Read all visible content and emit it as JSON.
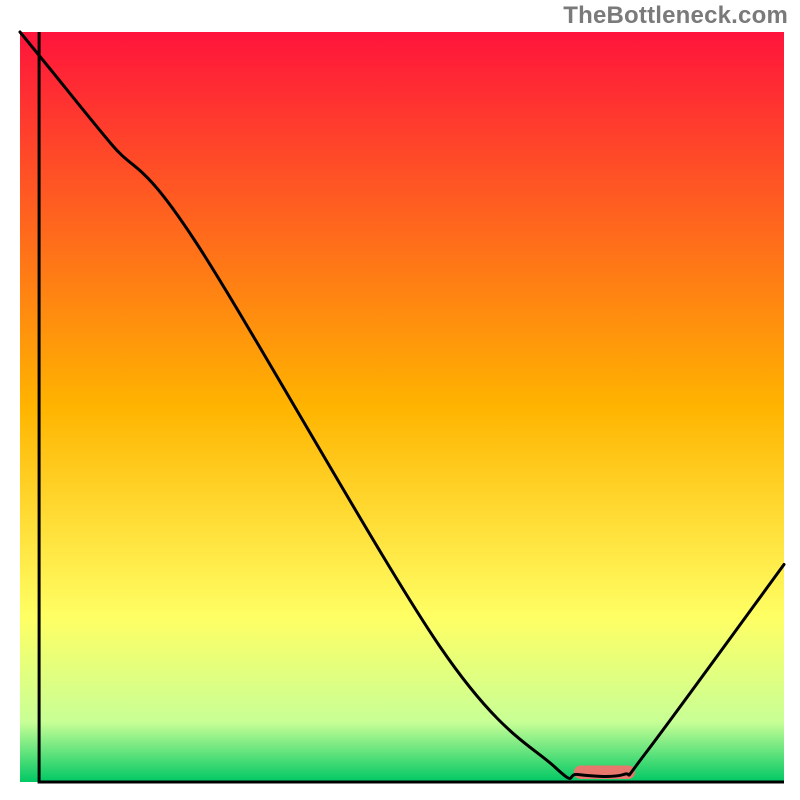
{
  "watermark": "TheBottleneck.com",
  "chart_data": {
    "type": "line",
    "title": "",
    "xlabel": "",
    "ylabel": "",
    "xlim": [
      0,
      100
    ],
    "ylim": [
      0,
      100
    ],
    "grid": false,
    "legend": false,
    "background_gradient": {
      "stops": [
        {
          "pct": 0,
          "color": "#ff143c"
        },
        {
          "pct": 50,
          "color": "#ffb400"
        },
        {
          "pct": 78,
          "color": "#ffff64"
        },
        {
          "pct": 92,
          "color": "#c8ff96"
        },
        {
          "pct": 100,
          "color": "#00c864"
        }
      ]
    },
    "series": [
      {
        "name": "curve",
        "color": "#000000",
        "x": [
          0,
          4,
          12,
          23,
          55,
          70,
          73,
          79,
          82,
          100
        ],
        "y": [
          100,
          95,
          85,
          72,
          18,
          2,
          1,
          1,
          4,
          29
        ]
      }
    ],
    "marker": {
      "name": "optimal-zone",
      "x": 76.5,
      "y": 1.3,
      "width": 8,
      "height": 1.8,
      "color": "#e8786e"
    },
    "frame_left_x": 2.5,
    "frame_bottom_y": 0
  }
}
